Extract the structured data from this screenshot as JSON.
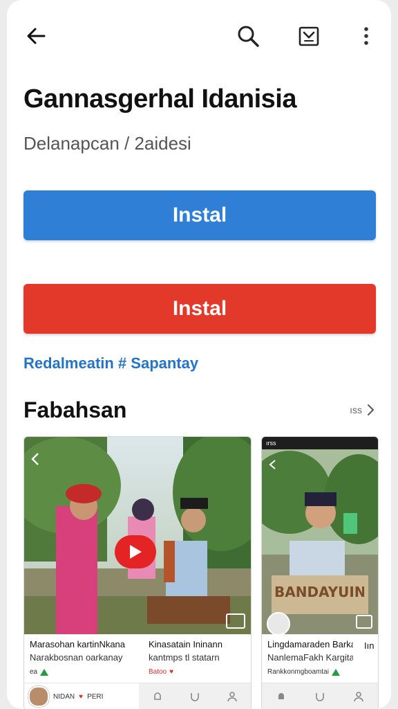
{
  "header": {
    "back_icon": "arrow-left-icon",
    "search_icon": "search-icon",
    "cart_icon": "shopping-bag-icon",
    "menu_icon": "more-vert-icon"
  },
  "app": {
    "title": "Gannasgerhal Idanisia",
    "subtitle": "Delanapcan / 2aidesi"
  },
  "buttons": {
    "primary_label": "Instal",
    "secondary_label": "Instal"
  },
  "link_text": "Redalmeatin # Sapantay",
  "section": {
    "title": "Fabahsan",
    "more_label": "ıss"
  },
  "cards": [
    {
      "line1": "Marasohan kartinNkana",
      "line2": "Narakbosnan oarkanay",
      "meta": "ea",
      "footer_text": "NIDAN",
      "footer_extra": "PERI"
    },
    {
      "line1": "Kinasatain Ininann",
      "line2": "kantmps tl statarn",
      "meta": "Batoo"
    },
    {
      "line1": "Lingdamaraden Barkan",
      "line2": "NanlemaFakh Kargitai",
      "meta": "Rankkonmgboamtai",
      "extra_label": "Iın",
      "sign_text": "BANDAYUIN",
      "status_bar": "ırss"
    }
  ],
  "colors": {
    "primary_blue": "#2f7fd6",
    "accent_red": "#e2392b",
    "link_blue": "#2573c4",
    "heart_red": "#d9302c",
    "green_badge": "#2a9a3e"
  }
}
